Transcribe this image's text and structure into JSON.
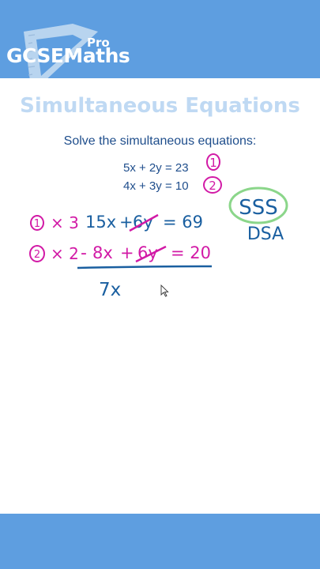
{
  "logo": {
    "brand_part1": "GCSE",
    "brand_part2": "Maths",
    "superscript": "Pro"
  },
  "title": "Simultaneous Equations",
  "instruction": "Solve the simultaneous equations:",
  "equations": [
    {
      "text": "5x + 2y = 23",
      "label": "1"
    },
    {
      "text": "4x + 3y = 10",
      "label": "2"
    }
  ],
  "handwriting": {
    "step1": {
      "marker": "1",
      "multiplier": "× 3",
      "term1": "15x",
      "plus": "+",
      "term2": "6y",
      "equals": "= 69"
    },
    "step2": {
      "marker": "2",
      "multiplier": "× 2",
      "minus": "-",
      "term1": "8x",
      "plus": "+",
      "term2": "6y",
      "equals": "= 20"
    },
    "result_partial": "7x",
    "mnemonic": "SSS",
    "mnemonic_sub": "DSA"
  },
  "colors": {
    "header": "#5e9ee0",
    "title": "#bfd9f3",
    "text": "#1f4e8c",
    "ink_blue": "#1a5fa0",
    "ink_magenta": "#d21aa6",
    "ink_green": "#8bd68a"
  }
}
